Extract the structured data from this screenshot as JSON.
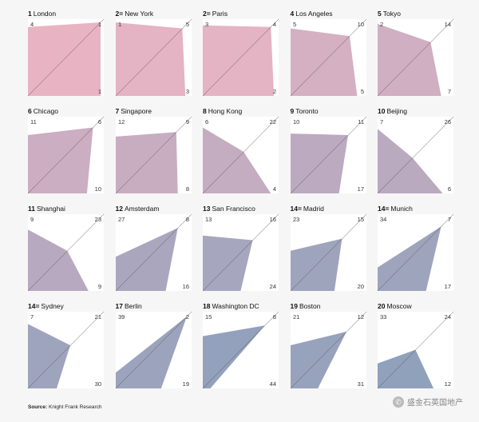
{
  "chart_data": {
    "type": "grid-of-rank-quadrilaterals",
    "corner_order": [
      "top-left",
      "top-right",
      "bottom-right"
    ],
    "max_rank": 44,
    "cities": [
      {
        "rank_label": "1",
        "city": "London",
        "corners": [
          4,
          1,
          1
        ]
      },
      {
        "rank_label": "2=",
        "city": "New York",
        "corners": [
          1,
          5,
          3
        ]
      },
      {
        "rank_label": "2=",
        "city": "Paris",
        "corners": [
          3,
          4,
          2
        ]
      },
      {
        "rank_label": "4",
        "city": "Los Angeles",
        "corners": [
          5,
          10,
          5
        ]
      },
      {
        "rank_label": "5",
        "city": "Tokyo",
        "corners": [
          2,
          14,
          7
        ]
      },
      {
        "rank_label": "6",
        "city": "Chicago",
        "corners": [
          11,
          6,
          10
        ]
      },
      {
        "rank_label": "7",
        "city": "Singapore",
        "corners": [
          12,
          9,
          8
        ]
      },
      {
        "rank_label": "8",
        "city": "Hong Kong",
        "corners": [
          6,
          22,
          4
        ]
      },
      {
        "rank_label": "9",
        "city": "Toronto",
        "corners": [
          10,
          11,
          17
        ]
      },
      {
        "rank_label": "10",
        "city": "Beijing",
        "corners": [
          7,
          26,
          6
        ]
      },
      {
        "rank_label": "11",
        "city": "Shanghai",
        "corners": [
          9,
          23,
          9
        ]
      },
      {
        "rank_label": "12",
        "city": "Amsterdam",
        "corners": [
          27,
          8,
          16
        ]
      },
      {
        "rank_label": "13",
        "city": "San Francisco",
        "corners": [
          13,
          16,
          24
        ]
      },
      {
        "rank_label": "14=",
        "city": "Madrid",
        "corners": [
          23,
          15,
          20
        ]
      },
      {
        "rank_label": "14=",
        "city": "Munich",
        "corners": [
          34,
          7,
          17
        ]
      },
      {
        "rank_label": "14=",
        "city": "Sydney",
        "corners": [
          7,
          21,
          30
        ]
      },
      {
        "rank_label": "17",
        "city": "Berlin",
        "corners": [
          39,
          2,
          19
        ]
      },
      {
        "rank_label": "18",
        "city": "Washington DC",
        "corners": [
          15,
          8,
          44
        ]
      },
      {
        "rank_label": "19",
        "city": "Boston",
        "corners": [
          21,
          12,
          31
        ]
      },
      {
        "rank_label": "20",
        "city": "Moscow",
        "corners": [
          33,
          24,
          12
        ]
      }
    ]
  },
  "source": {
    "prefix": "Source:",
    "text": "Knight Frank Research"
  },
  "watermark": {
    "text": "盛金石英国地产"
  },
  "colors": {
    "high": "#e8b4c4",
    "low": "#7f9dba",
    "cell_bg": "#ffffff",
    "page_bg": "#f6f6f6"
  }
}
